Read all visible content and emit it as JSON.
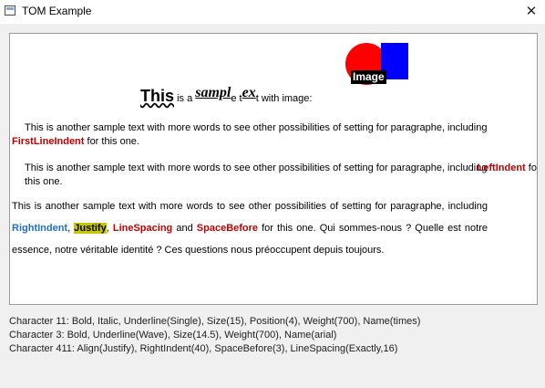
{
  "window": {
    "title": "TOM Example",
    "close_symbol": "✕"
  },
  "editor": {
    "line1": {
      "word_this": "This",
      "text_is_a": " is a ",
      "word_sampl": "sampl",
      "text_e_t": "e t",
      "word_ex": "ex",
      "text_with_image": "t with image:",
      "image_label": "Image"
    },
    "para2": {
      "text": "This is another sample text with more words to see other possibilities of setting for paragraphe, including ",
      "emph": "FirstLineIndent",
      "tail": " for this one."
    },
    "para3": {
      "text": "This is another sample text with more words to see other possibilities of setting for paragraphe, including ",
      "emph": "LeftIndent",
      "tail": " for this one."
    },
    "para4": {
      "text_a": "This is another sample text with more words to see other possibilities of setting for paragraphe, including ",
      "right_indent": "RightIndent",
      "comma1": ", ",
      "justify": "Justify",
      "comma2": ", ",
      "line_spacing": "LineSpacing",
      "text_and": " and ",
      "space_before": "SpaceBefore",
      "text_tail": " for this one. Qui sommes-nous ? Quelle est notre essence, notre véritable identité ? Ces questions nous préoccupent depuis toujours."
    }
  },
  "status_lines": [
    "Character 11: Bold, Italic, Underline(Single), Size(15), Position(4), Weight(700), Name(times)",
    "Character 3: Bold, Underline(Wave), Size(14.5), Weight(700), Name(arial)",
    "Character 411: Align(Justify), RightIndent(40), SpaceBefore(3), LineSpacing(Exactly,16)"
  ],
  "colors": {
    "emphasis_red": "#c00000",
    "emphasis_blue": "#1f6fc6",
    "highlight": "#c8c800",
    "shape_red": "#ff0000",
    "shape_blue": "#0000ff"
  }
}
